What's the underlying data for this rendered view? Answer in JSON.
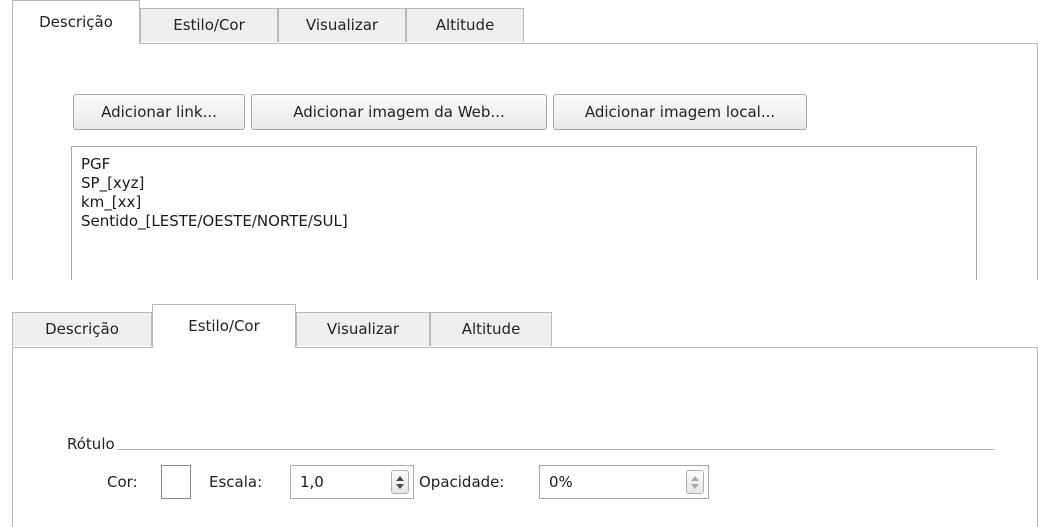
{
  "tabs": [
    "Descrição",
    "Estilo/Cor",
    "Visualizar",
    "Altitude"
  ],
  "description_panel": {
    "active_tab": "Descrição",
    "buttons": {
      "add_link": "Adicionar link...",
      "add_web_image": "Adicionar imagem da Web...",
      "add_local_image": "Adicionar imagem local..."
    },
    "text_lines": [
      "PGF",
      "SP_[xyz]",
      "km_[xx]",
      "Sentido_[LESTE/OESTE/NORTE/SUL]"
    ]
  },
  "style_panel": {
    "active_tab": "Estilo/Cor",
    "group_label": "Rótulo",
    "color_label": "Cor:",
    "color_value": "#ffffff",
    "scale_label": "Escala:",
    "scale_value": "1,0",
    "opacity_label": "Opacidade:",
    "opacity_value": "0%"
  }
}
